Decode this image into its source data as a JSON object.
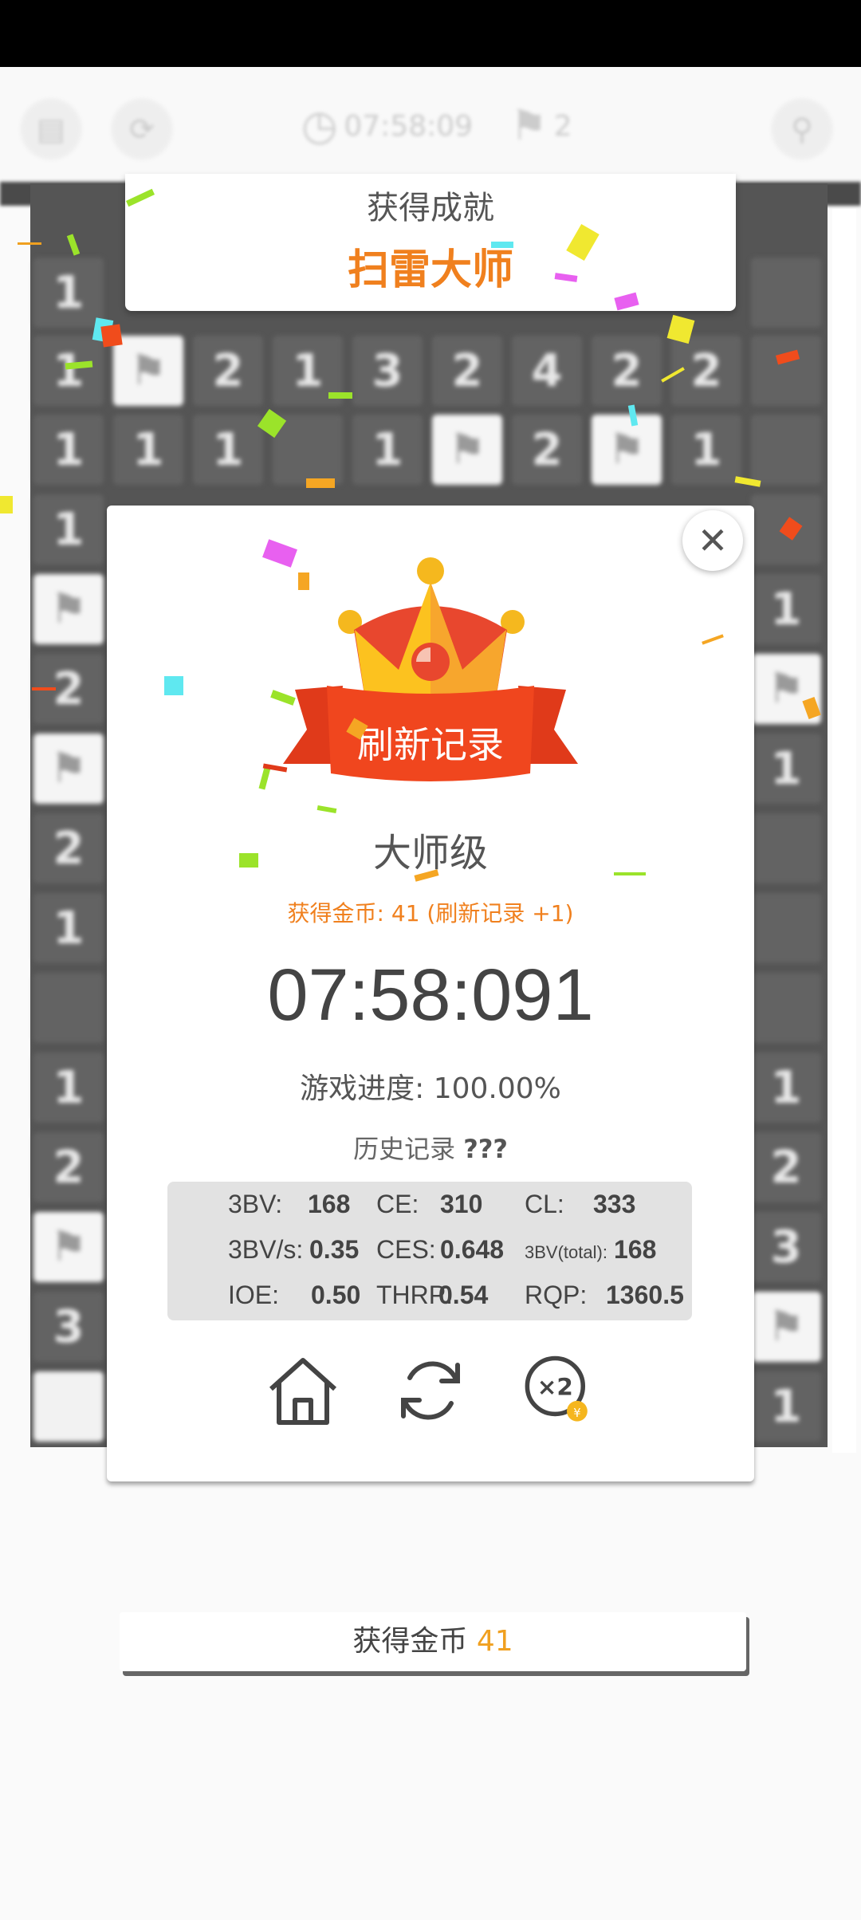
{
  "topbar": {
    "timer": "07:58:09",
    "flags": "2",
    "icons": [
      "menu-icon",
      "restart-icon",
      "clock-icon",
      "flag-icon",
      "settings-icon"
    ]
  },
  "board": {
    "row1": [
      "1"
    ],
    "row2": [
      "1",
      "",
      "2",
      "1",
      "3",
      "2",
      "4",
      "2",
      "2",
      ""
    ],
    "row3": [
      "1",
      "1",
      "1",
      "",
      "1",
      "",
      "2",
      "",
      "1",
      ""
    ],
    "left_column": [
      "1",
      "",
      "2",
      "",
      "2",
      "1",
      "",
      "1",
      "2",
      "",
      "3",
      ""
    ],
    "right_column": [
      "",
      "",
      "1",
      "",
      "1",
      "",
      "",
      "",
      "1",
      "2",
      "3",
      "",
      "1"
    ]
  },
  "achievement": {
    "title": "获得成就",
    "name": "扫雷大师"
  },
  "result": {
    "banner": "刷新记录",
    "level": "大师级",
    "coins_line": "获得金币: 41 (刷新记录 +1)",
    "time": "07:58:091",
    "progress_label": "游戏进度:",
    "progress_value": "100.00%",
    "history_label": "历史记录",
    "history_value": "???"
  },
  "stats": {
    "bv_label": "3BV:",
    "bv": "168",
    "ce_label": "CE:",
    "ce": "310",
    "cl_label": "CL:",
    "cl": "333",
    "bvs_label": "3BV/s:",
    "bvs": "0.35",
    "ces_label": "CES:",
    "ces": "0.648",
    "bvt_label": "3BV(total):",
    "bvt": "168",
    "ioe_label": "IOE:",
    "ioe": "0.50",
    "thrp_label": "THRP:",
    "thrp": "0.54",
    "rqp_label": "RQP:",
    "rqp": "1360.5"
  },
  "actions": {
    "home": "home-icon",
    "retry": "restart-icon",
    "double": "×2"
  },
  "coin_bar": {
    "label": "获得金币",
    "value": "41"
  }
}
